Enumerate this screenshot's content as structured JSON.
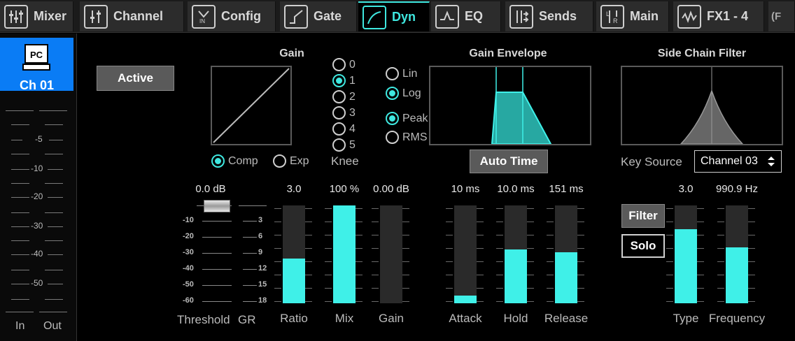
{
  "tabs": [
    {
      "label": "Mixer",
      "icon": "mixer-icon"
    },
    {
      "label": "Channel",
      "icon": "channel-icon"
    },
    {
      "label": "Config",
      "icon": "config-icon"
    },
    {
      "label": "Gate",
      "icon": "gate-icon"
    },
    {
      "label": "Dyn",
      "icon": "dyn-icon",
      "active": true
    },
    {
      "label": "EQ",
      "icon": "eq-icon"
    },
    {
      "label": "Sends",
      "icon": "sends-icon"
    },
    {
      "label": "Main",
      "icon": "main-icon"
    },
    {
      "label": "FX1 - 4",
      "icon": "fx-icon"
    }
  ],
  "tabs_overflow_label": "(F",
  "channel": {
    "icon_text": "PC",
    "name": "Ch 01"
  },
  "meter": {
    "labels": [
      "-5",
      "-10",
      "-20",
      "-30",
      "-40",
      "-50"
    ],
    "in_label": "In",
    "out_label": "Out"
  },
  "active_button": "Active",
  "gain": {
    "title": "Gain",
    "knee": {
      "label": "Knee",
      "options": [
        "0",
        "1",
        "2",
        "3",
        "4",
        "5"
      ],
      "selected": "1"
    },
    "mode": {
      "comp": "Comp",
      "exp": "Exp",
      "selected": "Comp"
    }
  },
  "envelope": {
    "title": "Gain Envelope",
    "lin": "Lin",
    "log": "Log",
    "scale_selected": "Log",
    "peak": "Peak",
    "rms": "RMS",
    "detect_selected": "Peak",
    "auto_time": "Auto Time"
  },
  "sidechain": {
    "title": "Side Chain Filter",
    "key_source_label": "Key Source",
    "key_source_value": "Channel 03",
    "filter_button": "Filter",
    "solo_button": "Solo"
  },
  "threshold": {
    "value": "0.0 dB",
    "label": "Threshold",
    "scale": [
      "-10",
      "-20",
      "-30",
      "-40",
      "-50",
      "-60"
    ]
  },
  "gr": {
    "label": "GR",
    "scale": [
      "3",
      "6",
      "9",
      "12",
      "15",
      "18"
    ]
  },
  "faders": [
    {
      "name": "ratio",
      "label": "Ratio",
      "value": "3.0",
      "level": 0.46
    },
    {
      "name": "mix",
      "label": "Mix",
      "value": "100 %",
      "level": 1.0
    },
    {
      "name": "gain",
      "label": "Gain",
      "value": "0.00 dB",
      "level": 0.0
    },
    {
      "name": "attack",
      "label": "Attack",
      "value": "10 ms",
      "level": 0.08
    },
    {
      "name": "hold",
      "label": "Hold",
      "value": "10.0 ms",
      "level": 0.55
    },
    {
      "name": "release",
      "label": "Release",
      "value": "151 ms",
      "level": 0.52
    },
    {
      "name": "type",
      "label": "Type",
      "value": "3.0",
      "level": 0.76
    },
    {
      "name": "frequency",
      "label": "Frequency",
      "value": "990.9 Hz",
      "level": 0.57
    }
  ],
  "colors": {
    "accent": "#3ff0e8",
    "channel_badge": "#0a7cf5"
  }
}
